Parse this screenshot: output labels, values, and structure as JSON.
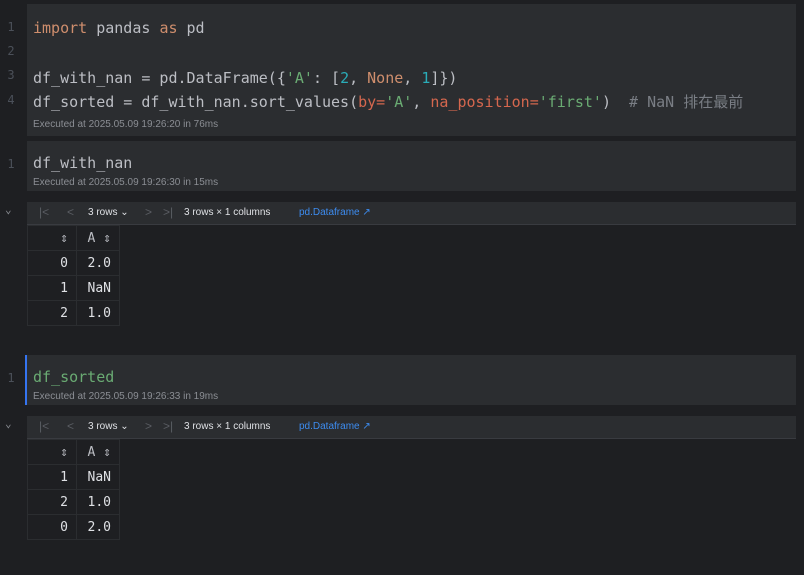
{
  "cell1": {
    "line_numbers": [
      "1",
      "2",
      "3",
      "4"
    ],
    "line1": {
      "kw1": "import",
      "mod": " pandas ",
      "kw2": "as",
      "alias": " pd"
    },
    "line3": {
      "a": "df_with_nan = pd.DataFrame({",
      "key": "'A'",
      "b": ": [",
      "n1": "2",
      "c": ", ",
      "none": "None",
      "d": ", ",
      "n2": "1",
      "e": "]})"
    },
    "line4": {
      "a": "df_sorted = df_with_nan.sort_values(",
      "p1": "by=",
      "v1": "'A'",
      "c": ", ",
      "p2": "na_position=",
      "v2": "'first'",
      "d": ")  ",
      "comment": "# NaN 排在最前"
    },
    "executed": "Executed at 2025.05.09 19:26:20 in 76ms"
  },
  "cell2": {
    "line_number": "1",
    "code": "df_with_nan",
    "executed": "Executed at 2025.05.09 19:26:30 in 15ms",
    "output": {
      "rows_select": "3 rows ⌄",
      "summary": "3 rows × 1 columns",
      "link": "pd.Dataframe ↗",
      "header": [
        "⇕",
        "A ⇕"
      ],
      "rows": [
        [
          "0",
          "2.0"
        ],
        [
          "1",
          "NaN"
        ],
        [
          "2",
          "1.0"
        ]
      ]
    }
  },
  "cell3": {
    "line_number": "1",
    "code": "df_sorted",
    "executed": "Executed at 2025.05.09 19:26:33 in 19ms",
    "output": {
      "rows_select": "3 rows ⌄",
      "summary": "3 rows × 1 columns",
      "link": "pd.Dataframe ↗",
      "header": [
        "⇕",
        "A ⇕"
      ],
      "rows": [
        [
          "1",
          "NaN"
        ],
        [
          "2",
          "1.0"
        ],
        [
          "0",
          "2.0"
        ]
      ]
    }
  },
  "nav": {
    "first": "|<",
    "prev": "<",
    "next": ">",
    "last": ">|",
    "collapse": "⌄"
  },
  "colors": {
    "accent": "#3574f0",
    "keyword": "#cf8e6d",
    "string": "#6aab73",
    "number": "#2aacb8",
    "link": "#3d8cf0"
  }
}
